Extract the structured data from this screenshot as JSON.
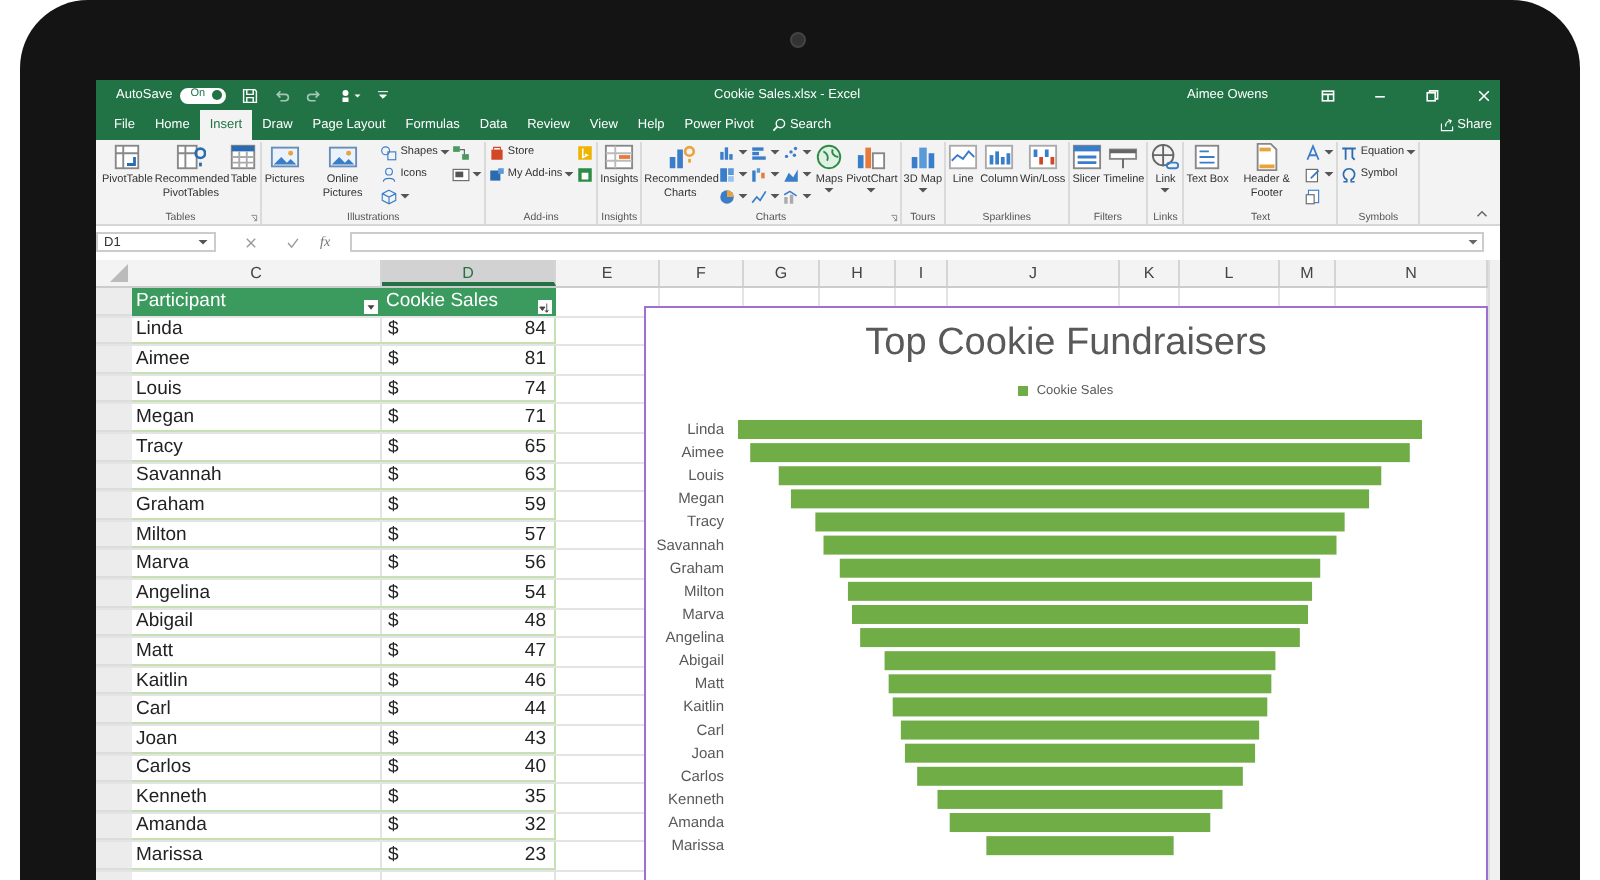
{
  "title_bar": {
    "autosave_label": "AutoSave",
    "autosave_toggle": {
      "label": "On",
      "on": true
    },
    "document_title": "Cookie Sales.xlsx - Excel",
    "user": "Aimee Owens"
  },
  "tabs": [
    {
      "label": "File",
      "selected": false
    },
    {
      "label": "Home",
      "selected": false
    },
    {
      "label": "Insert",
      "selected": true
    },
    {
      "label": "Draw",
      "selected": false
    },
    {
      "label": "Page Layout",
      "selected": false
    },
    {
      "label": "Formulas",
      "selected": false
    },
    {
      "label": "Data",
      "selected": false
    },
    {
      "label": "Review",
      "selected": false
    },
    {
      "label": "View",
      "selected": false
    },
    {
      "label": "Help",
      "selected": false
    },
    {
      "label": "Power Pivot",
      "selected": false
    }
  ],
  "search": {
    "label": "Search"
  },
  "share": {
    "label": "Share"
  },
  "ribbon_groups": [
    {
      "label": "Tables",
      "launcher": true,
      "buttons": [
        {
          "label": "PivotTable",
          "kind": "large"
        },
        {
          "label": "Recommended PivotTables",
          "kind": "large"
        },
        {
          "label": "Table",
          "kind": "large"
        }
      ]
    },
    {
      "label": "Illustrations",
      "buttons": [
        {
          "label": "Pictures",
          "kind": "large"
        },
        {
          "label": "Online Pictures",
          "kind": "large"
        },
        {
          "label": "Shapes",
          "kind": "small",
          "dropdown": true
        },
        {
          "label": "Icons",
          "kind": "small"
        },
        {
          "kind": "small",
          "dropdown": true
        },
        {
          "kind": "small"
        },
        {
          "kind": "small",
          "dropdown": true
        }
      ]
    },
    {
      "label": "Add-ins",
      "buttons": [
        {
          "label": "Store",
          "kind": "small"
        },
        {
          "label": "My Add-ins",
          "kind": "small",
          "dropdown": true
        },
        {
          "kind": "small"
        },
        {
          "kind": "small"
        }
      ]
    },
    {
      "label": "Insights",
      "buttons": [
        {
          "label": "Insights",
          "kind": "large"
        }
      ]
    },
    {
      "label": "Charts",
      "launcher": true,
      "buttons": [
        {
          "label": "Recommended Charts",
          "kind": "large"
        },
        {
          "kind": "small",
          "dropdown": true
        },
        {
          "kind": "small",
          "dropdown": true
        },
        {
          "kind": "small",
          "dropdown": true
        },
        {
          "kind": "small",
          "dropdown": true
        },
        {
          "kind": "small",
          "dropdown": true
        },
        {
          "kind": "small",
          "dropdown": true
        },
        {
          "kind": "small",
          "dropdown": true
        },
        {
          "kind": "small",
          "dropdown": true
        },
        {
          "kind": "small",
          "dropdown": true
        },
        {
          "label": "Maps",
          "kind": "large",
          "dropdown": true
        },
        {
          "label": "PivotChart",
          "kind": "large",
          "dropdown": true
        }
      ]
    },
    {
      "label": "Tours",
      "buttons": [
        {
          "label": "3D Map",
          "kind": "large",
          "dropdown": true
        }
      ]
    },
    {
      "label": "Sparklines",
      "buttons": [
        {
          "label": "Line",
          "kind": "large"
        },
        {
          "label": "Column",
          "kind": "large"
        },
        {
          "label": "Win/Loss",
          "kind": "large"
        }
      ]
    },
    {
      "label": "Filters",
      "buttons": [
        {
          "label": "Slicer",
          "kind": "large"
        },
        {
          "label": "Timeline",
          "kind": "large"
        }
      ]
    },
    {
      "label": "Links",
      "buttons": [
        {
          "label": "Link",
          "kind": "large",
          "dropdown": true
        }
      ]
    },
    {
      "label": "Text",
      "buttons": [
        {
          "label": "Text Box",
          "kind": "large"
        },
        {
          "label": "Header & Footer",
          "kind": "large"
        },
        {
          "kind": "small",
          "dropdown": true
        },
        {
          "kind": "small",
          "dropdown": true
        },
        {
          "kind": "small"
        }
      ]
    },
    {
      "label": "Symbols",
      "buttons": [
        {
          "label": "Equation",
          "kind": "small",
          "dropdown": true
        },
        {
          "label": "Symbol",
          "kind": "small"
        }
      ]
    }
  ],
  "formula_bar": {
    "name_box": "D1",
    "function_label": "fx"
  },
  "columns": [
    {
      "label": "C",
      "selected": false
    },
    {
      "label": "D",
      "selected": true
    },
    {
      "label": "E",
      "selected": false
    },
    {
      "label": "F",
      "selected": false
    },
    {
      "label": "G",
      "selected": false
    },
    {
      "label": "H",
      "selected": false
    },
    {
      "label": "I",
      "selected": false
    },
    {
      "label": "J",
      "selected": false
    },
    {
      "label": "K",
      "selected": false
    },
    {
      "label": "L",
      "selected": false
    },
    {
      "label": "M",
      "selected": false
    },
    {
      "label": "N",
      "selected": false
    }
  ],
  "table": {
    "headers": [
      "Participant",
      "Cookie Sales"
    ],
    "rows": [
      {
        "participant": "Linda",
        "currency": "$",
        "sales": "84"
      },
      {
        "participant": "Aimee",
        "currency": "$",
        "sales": "81"
      },
      {
        "participant": "Louis",
        "currency": "$",
        "sales": "74"
      },
      {
        "participant": "Megan",
        "currency": "$",
        "sales": "71"
      },
      {
        "participant": "Tracy",
        "currency": "$",
        "sales": "65"
      },
      {
        "participant": "Savannah",
        "currency": "$",
        "sales": "63"
      },
      {
        "participant": "Graham",
        "currency": "$",
        "sales": "59"
      },
      {
        "participant": "Milton",
        "currency": "$",
        "sales": "57"
      },
      {
        "participant": "Marva",
        "currency": "$",
        "sales": "56"
      },
      {
        "participant": "Angelina",
        "currency": "$",
        "sales": "54"
      },
      {
        "participant": "Abigail",
        "currency": "$",
        "sales": "48"
      },
      {
        "participant": "Matt",
        "currency": "$",
        "sales": "47"
      },
      {
        "participant": "Kaitlin",
        "currency": "$",
        "sales": "46"
      },
      {
        "participant": "Carl",
        "currency": "$",
        "sales": "44"
      },
      {
        "participant": "Joan",
        "currency": "$",
        "sales": "43"
      },
      {
        "participant": "Carlos",
        "currency": "$",
        "sales": "40"
      },
      {
        "participant": "Kenneth",
        "currency": "$",
        "sales": "35"
      },
      {
        "participant": "Amanda",
        "currency": "$",
        "sales": "32"
      },
      {
        "participant": "Marissa",
        "currency": "$",
        "sales": "23"
      }
    ]
  },
  "chart": {
    "title": "Top Cookie Fundraisers",
    "legend_label": "Cookie Sales",
    "labels": [
      "Linda",
      "Aimee",
      "Louis",
      "Megan",
      "Tracy",
      "Savannah",
      "Graham",
      "Milton",
      "Marva",
      "Angelina",
      "Abigail",
      "Matt",
      "Kaitlin",
      "Carl",
      "Joan",
      "Carlos",
      "Kenneth",
      "Amanda",
      "Marissa"
    ]
  }
}
